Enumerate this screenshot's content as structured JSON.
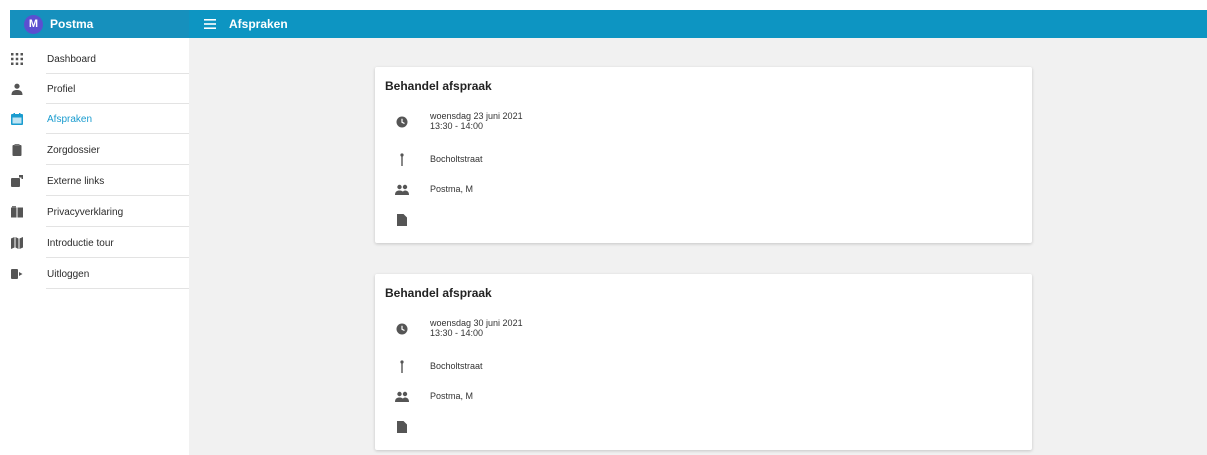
{
  "app": {
    "avatar_letter": "M",
    "user_name": "Postma",
    "page_title": "Afspraken",
    "topbar_color": "#0d95c2",
    "accent_color": "#1a9ccf"
  },
  "sidebar": {
    "items": [
      {
        "label": "Dashboard",
        "icon": "apps-grid-icon",
        "active": false
      },
      {
        "label": "Profiel",
        "icon": "person-icon",
        "active": false
      },
      {
        "label": "Afspraken",
        "icon": "calendar-icon",
        "active": true
      },
      {
        "label": "Zorgdossier",
        "icon": "clipboard-icon",
        "active": false
      },
      {
        "label": "Externe links",
        "icon": "external-link-icon",
        "active": false
      },
      {
        "label": "Privacyverklaring",
        "icon": "book-icon",
        "active": false
      },
      {
        "label": "Introductie tour",
        "icon": "map-icon",
        "active": false
      },
      {
        "label": "Uitloggen",
        "icon": "logout-icon",
        "active": false
      }
    ]
  },
  "appointments": [
    {
      "title": "Behandel afspraak",
      "date": "woensdag 23 juni 2021",
      "time": "13:30 - 14:00",
      "location": "Bocholtstraat",
      "attendee": "Postma, M"
    },
    {
      "title": "Behandel afspraak",
      "date": "woensdag 30 juni 2021",
      "time": "13:30 - 14:00",
      "location": "Bocholtstraat",
      "attendee": "Postma, M"
    }
  ]
}
